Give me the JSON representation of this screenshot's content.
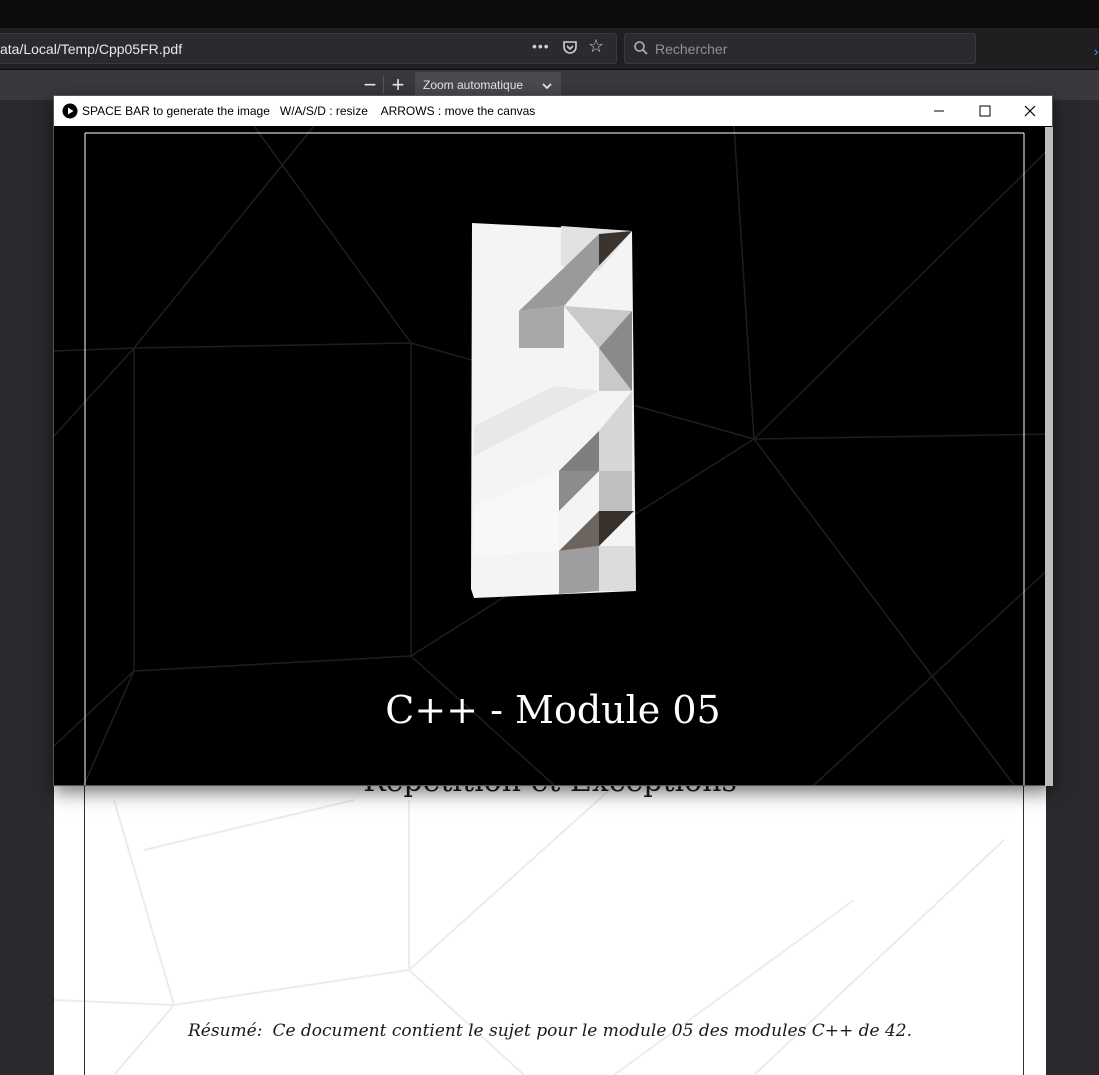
{
  "browser": {
    "url": "ata/Local/Temp/Cpp05FR.pdf",
    "page_actions_icon": "more-dots",
    "pocket_icon": "pocket",
    "bookmark_icon": "star",
    "search_placeholder": "Rechercher"
  },
  "pdf_toolbar": {
    "zoom_out": "−",
    "zoom_in": "+",
    "zoom_label": "Zoom automatique"
  },
  "pdf_page": {
    "subtitle": "Répétition et Exceptions",
    "abstract_label": "Résumé:",
    "abstract_text": "Ce document contient le sujet pour le module 05 des modules C++ de 42."
  },
  "app_window": {
    "title": "SPACE BAR to generate the image   W/A/S/D : resize    ARROWS : move the canvas",
    "minimize_icon": "minimize",
    "maximize_icon": "maximize",
    "close_icon": "close",
    "canvas_title": "C++ - Module 05"
  },
  "colors": {
    "chrome_dark": "#0c0c0d",
    "urlbar": "#1f1f22",
    "pdf_toolbar": "#38383d",
    "viewer_bg": "#2a2a2e",
    "canvas_bg": "#000000"
  }
}
